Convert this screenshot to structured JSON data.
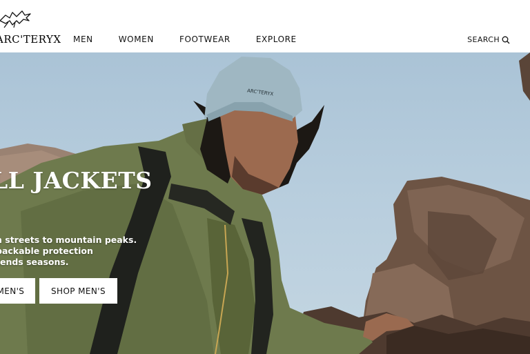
{
  "brand": {
    "name": "ARC'TERYX",
    "logo_icon": "archaeopteryx-logo-icon"
  },
  "nav": {
    "items": [
      {
        "label": "MEN"
      },
      {
        "label": "WOMEN"
      },
      {
        "label": "FOOTWEAR"
      },
      {
        "label": "EXPLORE"
      }
    ]
  },
  "search": {
    "label": "SEARCH",
    "icon": "search-icon"
  },
  "hero": {
    "title": "LL JACKETS",
    "copy_lines": [
      "n streets to mountain peaks.",
      "packable protection",
      "tends seasons."
    ],
    "cta_women": "OMEN'S",
    "cta_men": "SHOP MEN'S",
    "beanie_text": "ARC'TERYX"
  }
}
